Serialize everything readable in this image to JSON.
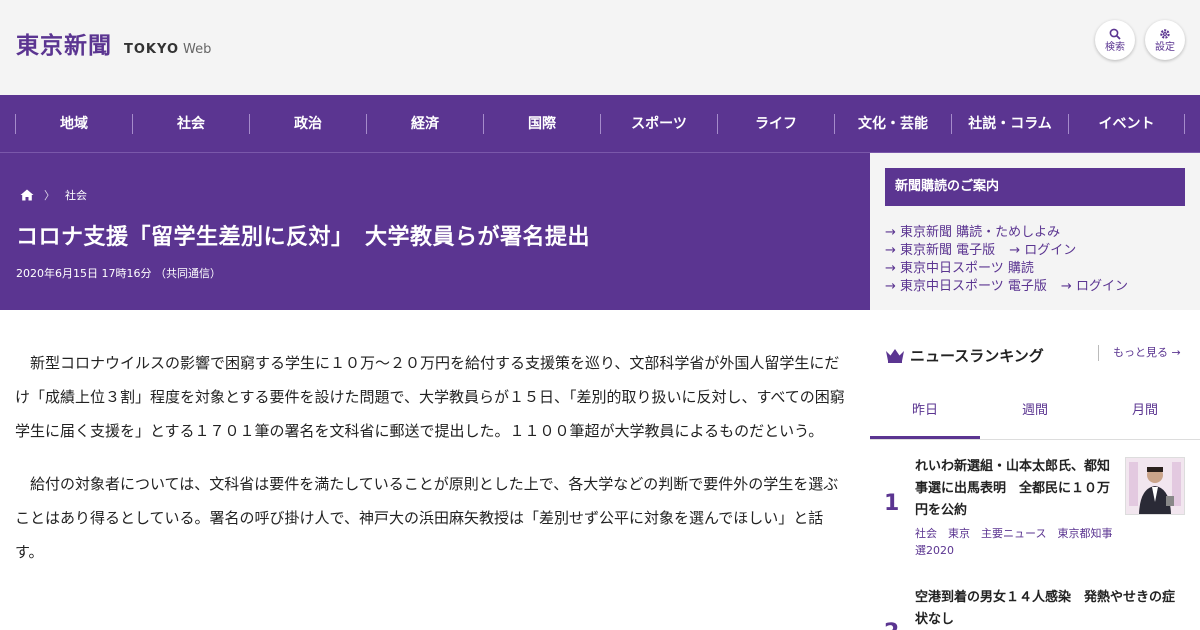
{
  "header": {
    "logo_jp": "東京新聞",
    "logo_en_bold": "TOKYO",
    "logo_en_light": "Web",
    "search_label": "検索",
    "settings_label": "設定"
  },
  "nav": [
    "地域",
    "社会",
    "政治",
    "経済",
    "国際",
    "スポーツ",
    "ライフ",
    "文化・芸能",
    "社説・コラム",
    "イベント"
  ],
  "article": {
    "breadcrumb_category": "社会",
    "headline": "コロナ支援「留学生差別に反対」　大学教員らが署名提出",
    "dateline": "2020年6月15日 17時16分 （共同通信）",
    "paragraphs": [
      "新型コロナウイルスの影響で困窮する学生に１０万～２０万円を給付する支援策を巡り、文部科学省が外国人留学生にだけ「成績上位３割」程度を対象とする要件を設けた問題で、大学教員らが１５日、「差別的取り扱いに反対し、すべての困窮学生に届く支援を」とする１７０１筆の署名を文科省に郵送で提出した。１１００筆超が大学教員によるものだという。",
      "給付の対象者については、文科省は要件を満たしていることが原則とした上で、各大学などの判断で要件外の学生を選ぶことはあり得るとしている。署名の呼び掛け人で、神戸大の浜田麻矢教授は「差別せず公平に対象を選んでほしい」と話す。"
    ]
  },
  "sidebar": {
    "subscription_title": "新聞購読のご案内",
    "links": {
      "row1": "東京新聞 購読・ためしよみ",
      "row2a": "東京新聞 電子版",
      "row2b": "ログイン",
      "row3": "東京中日スポーツ 購読",
      "row4a": "東京中日スポーツ 電子版",
      "row4b": "ログイン"
    },
    "ranking_title": "ニュースランキング",
    "more_label": "もっと見る",
    "tabs": [
      "昨日",
      "週間",
      "月間"
    ],
    "items": [
      {
        "rank": "1",
        "title": "れいわ新選組・山本太郎氏、都知事選に出馬表明　全都民に１０万円を公約",
        "tags": "社会　東京　主要ニュース　東京都知事選2020"
      },
      {
        "rank": "2",
        "title": "空港到着の男女１４人感染　発熱やせきの症状なし"
      }
    ]
  }
}
